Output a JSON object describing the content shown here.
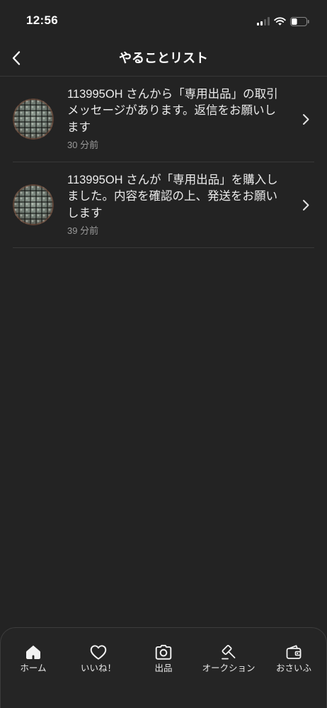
{
  "status_bar": {
    "time": "12:56",
    "signal_icon": "signal-icon",
    "signal_bars_active": 2,
    "signal_bars_total": 4,
    "wifi_icon": "wifi-icon",
    "battery_icon": "battery-icon",
    "battery_level": 0.4
  },
  "header": {
    "back_icon": "chevron-left-icon",
    "title": "やることリスト"
  },
  "todo_list": {
    "items": [
      {
        "message_lines": [
          "113995OH さんから「専用出品」の取引",
          "メッセージがあります。返信をお願いし",
          "ます"
        ],
        "time_ago": "30 分前",
        "chevron_icon": "chevron-right-icon"
      },
      {
        "message_lines": [
          "113995OH さんが「専用出品」を購入し",
          "ました。内容を確認の上、発送をお願い",
          "します"
        ],
        "time_ago": "39 分前",
        "chevron_icon": "chevron-right-icon"
      }
    ]
  },
  "tab_bar": {
    "tabs": [
      {
        "label": "ホーム",
        "icon": "home-icon",
        "active": true
      },
      {
        "label": "いいね！",
        "icon": "heart-icon",
        "active": false
      },
      {
        "label": "出品",
        "icon": "camera-icon",
        "active": false
      },
      {
        "label": "オークション",
        "icon": "gavel-icon",
        "active": false
      },
      {
        "label": "おさいふ",
        "icon": "wallet-icon",
        "active": false
      }
    ]
  },
  "colors": {
    "background": "#232323",
    "text_primary": "#ececec",
    "text_secondary": "#9a9a9a",
    "divider": "#383838",
    "icon": "#f2f2f2"
  }
}
